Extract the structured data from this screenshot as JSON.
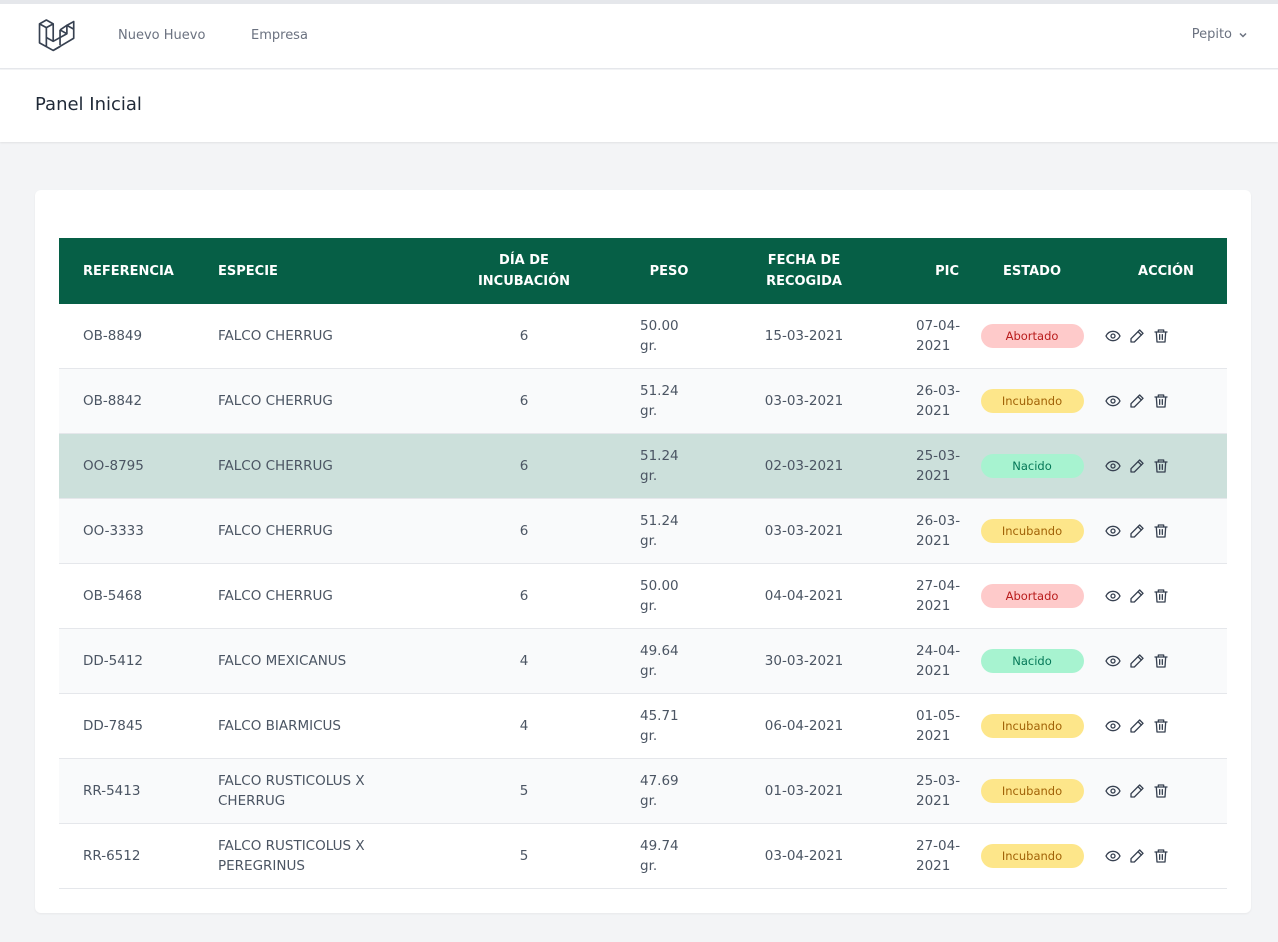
{
  "nav": {
    "links": [
      "Nuevo Huevo",
      "Empresa"
    ],
    "user": "Pepito"
  },
  "header": {
    "title": "Panel Inicial"
  },
  "table": {
    "columns": [
      "REFERENCIA",
      "ESPECIE",
      "DÍA DE INCUBACIÓN",
      "PESO",
      "FECHA DE RECOGIDA",
      "PIC",
      "ESTADO",
      "ACCIÓN"
    ],
    "rows": [
      {
        "ref": "OB-8849",
        "especie": "FALCO CHERRUG",
        "dia": "6",
        "peso": "50.00 gr.",
        "fecha": "15-03-2021",
        "pic": "07-04-2021",
        "estado": "Abortado"
      },
      {
        "ref": "OB-8842",
        "especie": "FALCO CHERRUG",
        "dia": "6",
        "peso": "51.24 gr.",
        "fecha": "03-03-2021",
        "pic": "26-03-2021",
        "estado": "Incubando"
      },
      {
        "ref": "OO-8795",
        "especie": "FALCO CHERRUG",
        "dia": "6",
        "peso": "51.24 gr.",
        "fecha": "02-03-2021",
        "pic": "25-03-2021",
        "estado": "Nacido"
      },
      {
        "ref": "OO-3333",
        "especie": "FALCO CHERRUG",
        "dia": "6",
        "peso": "51.24 gr.",
        "fecha": "03-03-2021",
        "pic": "26-03-2021",
        "estado": "Incubando"
      },
      {
        "ref": "OB-5468",
        "especie": "FALCO CHERRUG",
        "dia": "6",
        "peso": "50.00 gr.",
        "fecha": "04-04-2021",
        "pic": "27-04-2021",
        "estado": "Abortado"
      },
      {
        "ref": "DD-5412",
        "especie": "FALCO MEXICANUS",
        "dia": "4",
        "peso": "49.64 gr.",
        "fecha": "30-03-2021",
        "pic": "24-04-2021",
        "estado": "Nacido"
      },
      {
        "ref": "DD-7845",
        "especie": "FALCO BIARMICUS",
        "dia": "4",
        "peso": "45.71 gr.",
        "fecha": "06-04-2021",
        "pic": "01-05-2021",
        "estado": "Incubando"
      },
      {
        "ref": "RR-5413",
        "especie": "FALCO RUSTICOLUS X CHERRUG",
        "dia": "5",
        "peso": "47.69 gr.",
        "fecha": "01-03-2021",
        "pic": "25-03-2021",
        "estado": "Incubando"
      },
      {
        "ref": "RR-6512",
        "especie": "FALCO RUSTICOLUS X PEREGRINUS",
        "dia": "5",
        "peso": "49.74 gr.",
        "fecha": "03-04-2021",
        "pic": "27-04-2021",
        "estado": "Incubando"
      }
    ]
  },
  "status_colors": {
    "Abortado": "red",
    "Incubando": "yellow",
    "Nacido": "green"
  },
  "accent_color": "#065f46"
}
